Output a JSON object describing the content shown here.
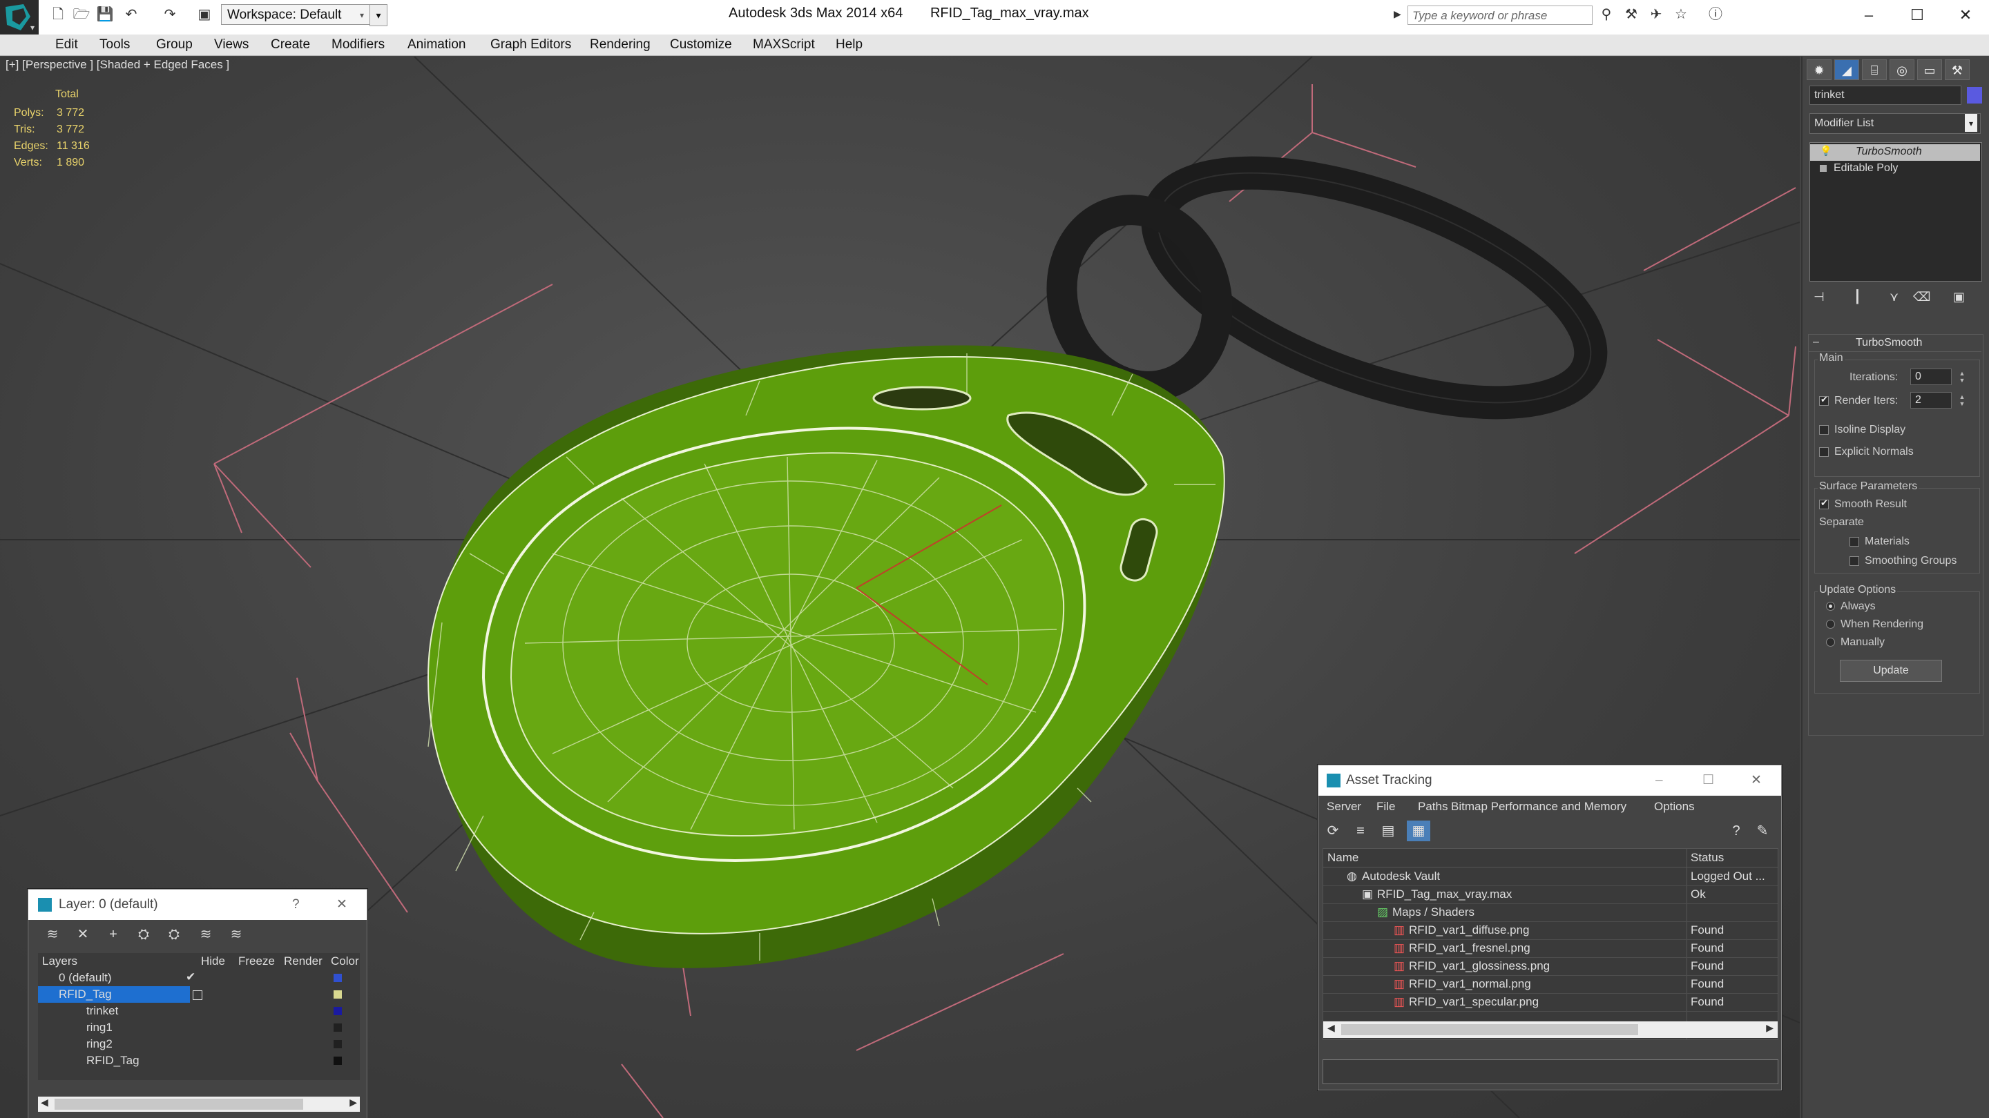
{
  "titlebar": {
    "app": "Autodesk 3ds Max  2014 x64",
    "file": "RFID_Tag_max_vray.max",
    "workspace": "Workspace: Default",
    "search_placeholder": "Type a keyword or phrase"
  },
  "menu": [
    "Edit",
    "Tools",
    "Group",
    "Views",
    "Create",
    "Modifiers",
    "Animation",
    "Graph Editors",
    "Rendering",
    "Customize",
    "MAXScript",
    "Help"
  ],
  "viewport": {
    "label": "[+] [Perspective ] [Shaded + Edged Faces ]",
    "stats": {
      "header": "Total",
      "rows": [
        {
          "label": "Polys:",
          "value": "3 772"
        },
        {
          "label": "Tris:",
          "value": "3 772"
        },
        {
          "label": "Edges:",
          "value": "11 316"
        },
        {
          "label": "Verts:",
          "value": "1 890"
        }
      ]
    }
  },
  "command_panel": {
    "object_name": "trinket",
    "modifier_list": "Modifier List",
    "stack": [
      "TurboSmooth",
      "Editable Poly"
    ],
    "turbosmooth": {
      "title": "TurboSmooth",
      "main": "Main",
      "iterations_label": "Iterations:",
      "iterations_value": "0",
      "render_iters_label": "Render Iters:",
      "render_iters_value": "2",
      "isoline": "Isoline Display",
      "explicit": "Explicit Normals",
      "surface": "Surface Parameters",
      "smooth_result": "Smooth Result",
      "separate": "Separate",
      "materials": "Materials",
      "smoothing_groups": "Smoothing Groups",
      "update_options": "Update Options",
      "always": "Always",
      "when_rendering": "When Rendering",
      "manually": "Manually",
      "update_btn": "Update"
    }
  },
  "layer_window": {
    "title": "Layer: 0 (default)",
    "help": "?",
    "columns": [
      "Layers",
      "Hide",
      "Freeze",
      "Render",
      "Color"
    ],
    "rows": [
      {
        "name": "0 (default)",
        "color": "#3050d0",
        "indent": 1
      },
      {
        "name": "RFID_Tag",
        "color": "#d8d890",
        "indent": 1,
        "selected": true
      },
      {
        "name": "trinket",
        "color": "#1a1aa0",
        "indent": 2
      },
      {
        "name": "ring1",
        "color": "#202020",
        "indent": 2
      },
      {
        "name": "ring2",
        "color": "#202020",
        "indent": 2
      },
      {
        "name": "RFID_Tag",
        "color": "#101010",
        "indent": 2
      }
    ]
  },
  "asset_window": {
    "title": "Asset Tracking",
    "menu": [
      "Server",
      "File",
      "Paths",
      "Bitmap Performance and Memory",
      "Options"
    ],
    "columns": [
      "Name",
      "Status"
    ],
    "rows": [
      {
        "name": "Autodesk Vault",
        "status": "Logged Out ...",
        "level": 0
      },
      {
        "name": "RFID_Tag_max_vray.max",
        "status": "Ok",
        "level": 1
      },
      {
        "name": "Maps / Shaders",
        "status": "",
        "level": 2
      },
      {
        "name": "RFID_var1_diffuse.png",
        "status": "Found",
        "level": 3
      },
      {
        "name": "RFID_var1_fresnel.png",
        "status": "Found",
        "level": 3
      },
      {
        "name": "RFID_var1_glossiness.png",
        "status": "Found",
        "level": 3
      },
      {
        "name": "RFID_var1_normal.png",
        "status": "Found",
        "level": 3
      },
      {
        "name": "RFID_var1_specular.png",
        "status": "Found",
        "level": 3
      }
    ]
  },
  "colors": {
    "mesh_green": "#5d9e0c",
    "accent_blue": "#1e6fd0",
    "stats_yellow": "#e9d36b"
  }
}
